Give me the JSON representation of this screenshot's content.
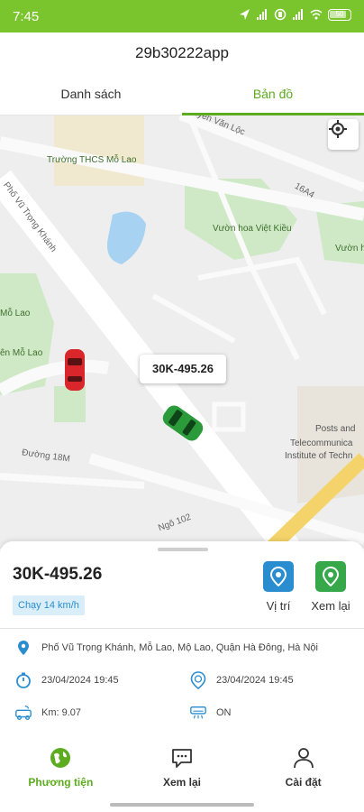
{
  "status_bar": {
    "time": "7:45",
    "battery": "50"
  },
  "header": {
    "title": "29b30222app"
  },
  "tabs": [
    {
      "label": "Danh sách",
      "active": false
    },
    {
      "label": "Bản đồ",
      "active": true
    }
  ],
  "map": {
    "labels": {
      "school": "Trường THCS Mỗ Lao",
      "road_main": "Phố Vũ Trọng Khánh",
      "road_top": "Nguyễn Văn Lộc",
      "road_16a4": "16A4",
      "park1": "Vườn hoa Việt Kiều",
      "park2": "Vườn h",
      "park3": "Mỗ Lao",
      "park4": "ên Mỗ Lao",
      "road_18m": "Đường 18M",
      "road_102": "Ngõ 102",
      "institute_1": "Posts and",
      "institute_2": "Telecommunica",
      "institute_3": "Institute of Techn"
    },
    "popup_plate": "30K-495.26"
  },
  "vehicle": {
    "plate": "30K-495.26",
    "speed": "Chạy 14 km/h",
    "address": "Phố Vũ Trọng Khánh, Mỗ Lao, Mộ Lao, Quận Hà Đông, Hà Nội",
    "time_1": "23/04/2024 19:45",
    "time_2": "23/04/2024 19:45",
    "km": "Km: 9.07",
    "ac": "ON"
  },
  "actions": [
    {
      "label": "Vị trí",
      "color": "#2a8dcf"
    },
    {
      "label": "Xem lại",
      "color": "#36a84a"
    }
  ],
  "bottom_nav": [
    {
      "label": "Phương tiện",
      "icon": "globe-icon",
      "active": true
    },
    {
      "label": "Xem lại",
      "icon": "chat-icon",
      "active": false
    },
    {
      "label": "Cài đặt",
      "icon": "user-icon",
      "active": false
    }
  ],
  "colors": {
    "accent": "#7ac52d",
    "active_text": "#5dab1f",
    "blue": "#2a8dcf",
    "green": "#36a84a"
  }
}
